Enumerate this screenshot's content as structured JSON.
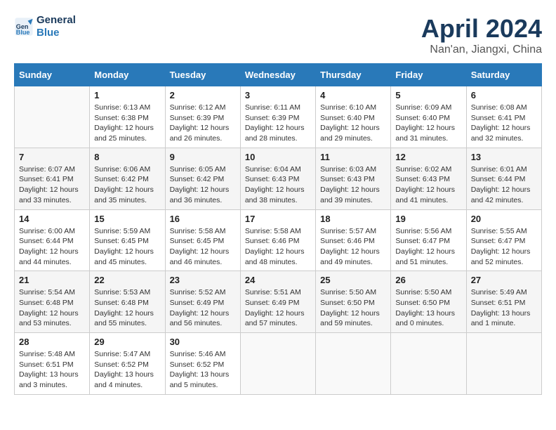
{
  "header": {
    "logo_line1": "General",
    "logo_line2": "Blue",
    "title": "April 2024",
    "subtitle": "Nan'an, Jiangxi, China"
  },
  "calendar": {
    "weekdays": [
      "Sunday",
      "Monday",
      "Tuesday",
      "Wednesday",
      "Thursday",
      "Friday",
      "Saturday"
    ],
    "weeks": [
      [
        {
          "day": "",
          "info": ""
        },
        {
          "day": "1",
          "info": "Sunrise: 6:13 AM\nSunset: 6:38 PM\nDaylight: 12 hours\nand 25 minutes."
        },
        {
          "day": "2",
          "info": "Sunrise: 6:12 AM\nSunset: 6:39 PM\nDaylight: 12 hours\nand 26 minutes."
        },
        {
          "day": "3",
          "info": "Sunrise: 6:11 AM\nSunset: 6:39 PM\nDaylight: 12 hours\nand 28 minutes."
        },
        {
          "day": "4",
          "info": "Sunrise: 6:10 AM\nSunset: 6:40 PM\nDaylight: 12 hours\nand 29 minutes."
        },
        {
          "day": "5",
          "info": "Sunrise: 6:09 AM\nSunset: 6:40 PM\nDaylight: 12 hours\nand 31 minutes."
        },
        {
          "day": "6",
          "info": "Sunrise: 6:08 AM\nSunset: 6:41 PM\nDaylight: 12 hours\nand 32 minutes."
        }
      ],
      [
        {
          "day": "7",
          "info": "Sunrise: 6:07 AM\nSunset: 6:41 PM\nDaylight: 12 hours\nand 33 minutes."
        },
        {
          "day": "8",
          "info": "Sunrise: 6:06 AM\nSunset: 6:42 PM\nDaylight: 12 hours\nand 35 minutes."
        },
        {
          "day": "9",
          "info": "Sunrise: 6:05 AM\nSunset: 6:42 PM\nDaylight: 12 hours\nand 36 minutes."
        },
        {
          "day": "10",
          "info": "Sunrise: 6:04 AM\nSunset: 6:43 PM\nDaylight: 12 hours\nand 38 minutes."
        },
        {
          "day": "11",
          "info": "Sunrise: 6:03 AM\nSunset: 6:43 PM\nDaylight: 12 hours\nand 39 minutes."
        },
        {
          "day": "12",
          "info": "Sunrise: 6:02 AM\nSunset: 6:43 PM\nDaylight: 12 hours\nand 41 minutes."
        },
        {
          "day": "13",
          "info": "Sunrise: 6:01 AM\nSunset: 6:44 PM\nDaylight: 12 hours\nand 42 minutes."
        }
      ],
      [
        {
          "day": "14",
          "info": "Sunrise: 6:00 AM\nSunset: 6:44 PM\nDaylight: 12 hours\nand 44 minutes."
        },
        {
          "day": "15",
          "info": "Sunrise: 5:59 AM\nSunset: 6:45 PM\nDaylight: 12 hours\nand 45 minutes."
        },
        {
          "day": "16",
          "info": "Sunrise: 5:58 AM\nSunset: 6:45 PM\nDaylight: 12 hours\nand 46 minutes."
        },
        {
          "day": "17",
          "info": "Sunrise: 5:58 AM\nSunset: 6:46 PM\nDaylight: 12 hours\nand 48 minutes."
        },
        {
          "day": "18",
          "info": "Sunrise: 5:57 AM\nSunset: 6:46 PM\nDaylight: 12 hours\nand 49 minutes."
        },
        {
          "day": "19",
          "info": "Sunrise: 5:56 AM\nSunset: 6:47 PM\nDaylight: 12 hours\nand 51 minutes."
        },
        {
          "day": "20",
          "info": "Sunrise: 5:55 AM\nSunset: 6:47 PM\nDaylight: 12 hours\nand 52 minutes."
        }
      ],
      [
        {
          "day": "21",
          "info": "Sunrise: 5:54 AM\nSunset: 6:48 PM\nDaylight: 12 hours\nand 53 minutes."
        },
        {
          "day": "22",
          "info": "Sunrise: 5:53 AM\nSunset: 6:48 PM\nDaylight: 12 hours\nand 55 minutes."
        },
        {
          "day": "23",
          "info": "Sunrise: 5:52 AM\nSunset: 6:49 PM\nDaylight: 12 hours\nand 56 minutes."
        },
        {
          "day": "24",
          "info": "Sunrise: 5:51 AM\nSunset: 6:49 PM\nDaylight: 12 hours\nand 57 minutes."
        },
        {
          "day": "25",
          "info": "Sunrise: 5:50 AM\nSunset: 6:50 PM\nDaylight: 12 hours\nand 59 minutes."
        },
        {
          "day": "26",
          "info": "Sunrise: 5:50 AM\nSunset: 6:50 PM\nDaylight: 13 hours\nand 0 minutes."
        },
        {
          "day": "27",
          "info": "Sunrise: 5:49 AM\nSunset: 6:51 PM\nDaylight: 13 hours\nand 1 minute."
        }
      ],
      [
        {
          "day": "28",
          "info": "Sunrise: 5:48 AM\nSunset: 6:51 PM\nDaylight: 13 hours\nand 3 minutes."
        },
        {
          "day": "29",
          "info": "Sunrise: 5:47 AM\nSunset: 6:52 PM\nDaylight: 13 hours\nand 4 minutes."
        },
        {
          "day": "30",
          "info": "Sunrise: 5:46 AM\nSunset: 6:52 PM\nDaylight: 13 hours\nand 5 minutes."
        },
        {
          "day": "",
          "info": ""
        },
        {
          "day": "",
          "info": ""
        },
        {
          "day": "",
          "info": ""
        },
        {
          "day": "",
          "info": ""
        }
      ]
    ]
  }
}
